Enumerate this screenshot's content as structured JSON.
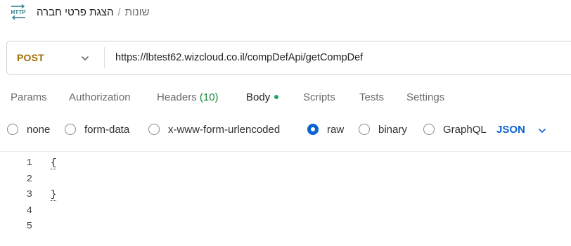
{
  "header": {
    "icon_text": "HTTP",
    "breadcrumb_parent": "שונות",
    "breadcrumb_separator": "/",
    "breadcrumb_current": "הצגת פרטי חברה"
  },
  "request": {
    "method": "POST",
    "url": "https://lbtest62.wizcloud.co.il/compDefApi/getCompDef"
  },
  "tabs": [
    {
      "label": "Params"
    },
    {
      "label": "Authorization"
    },
    {
      "label": "Headers",
      "count": "(10)"
    },
    {
      "label": "Body",
      "active": true,
      "modified_dot": true
    },
    {
      "label": "Scripts"
    },
    {
      "label": "Tests"
    },
    {
      "label": "Settings"
    }
  ],
  "body_types": [
    {
      "label": "none",
      "selected": false
    },
    {
      "label": "form-data",
      "selected": false
    },
    {
      "label": "x-www-form-urlencoded",
      "selected": false
    },
    {
      "label": "raw",
      "selected": true
    },
    {
      "label": "binary",
      "selected": false
    },
    {
      "label": "GraphQL",
      "selected": false
    }
  ],
  "raw_format": "JSON",
  "editor": {
    "lines": [
      {
        "number": "1",
        "text": "{"
      },
      {
        "number": "2",
        "text": ""
      },
      {
        "number": "3",
        "text": "}"
      },
      {
        "number": "4",
        "text": ""
      },
      {
        "number": "5",
        "text": ""
      }
    ]
  },
  "colors": {
    "method": "#a06b00",
    "active_tab_underline": "#ff6c37",
    "headers_count": "#1a8a3c",
    "body_dot": "#1fa463",
    "radio_selected": "#0b63d1",
    "format_label": "#0b63d1"
  }
}
